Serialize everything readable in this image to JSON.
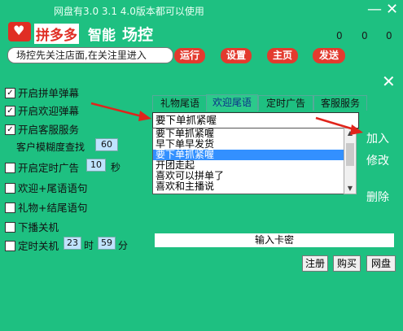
{
  "titlebar": {
    "version_text": "网盘有3.0   3.1  4.0版本都可以使用",
    "minimize": "—",
    "close": "✕"
  },
  "logo": {
    "brand": "拼多多",
    "smart": "智能",
    "word": "场控"
  },
  "counters": [
    "0",
    "0",
    "0"
  ],
  "search": {
    "value": "场控先关注店面,在关注里进入"
  },
  "top_buttons": {
    "run": "运行",
    "settings": "设置",
    "home": "主页",
    "send": "发送"
  },
  "options": {
    "popup_order": {
      "label": "开启拼单弹幕",
      "checked": true
    },
    "popup_welcome": {
      "label": "开启欢迎弹幕",
      "checked": true
    },
    "service": {
      "label": "开启客服服务",
      "checked": true
    },
    "fuzzy": {
      "label": "客户模糊度查找",
      "value": "60"
    },
    "timed_ad": {
      "label": "开启定时广告",
      "checked": false,
      "value": "10",
      "unit": "秒"
    },
    "welcome_tail": {
      "label": "欢迎+尾语语句",
      "checked": false
    },
    "gift_tail": {
      "label": "礼物+结尾语句",
      "checked": false
    },
    "stop_shutdown": {
      "label": "下播关机",
      "checked": false
    },
    "timed_shutdown": {
      "label": "定时关机",
      "checked": false,
      "hour": "23",
      "hour_unit": "时",
      "minute": "59",
      "minute_unit": "分"
    }
  },
  "tabs": [
    "礼物尾语",
    "欢迎尾语",
    "定时广告",
    "客服服务"
  ],
  "active_tab": 1,
  "combo_value": "要下单抓紧喔",
  "list_items": [
    "要下单抓紧喔",
    "早下单早发货",
    "要下单抓紧喔",
    "开团走起",
    "喜欢可以拼单了",
    "喜欢和主播说"
  ],
  "selected_item": 2,
  "side_actions": {
    "add": "加入",
    "edit": "修改",
    "delete": "删除"
  },
  "key_placeholder": "输入卡密",
  "bottom_buttons": {
    "register": "注册",
    "buy": "购买",
    "netdisk": "网盘"
  },
  "colors": {
    "background": "#1ec081",
    "accent_red": "#e33a2e",
    "selection": "#3390ff"
  }
}
